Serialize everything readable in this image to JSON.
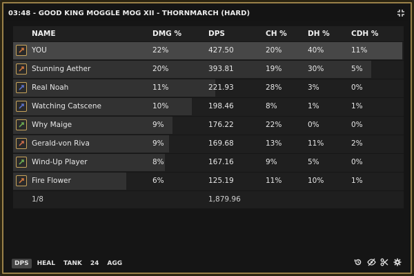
{
  "window": {
    "title": "03:48 - GOOD KING MOGGLE MOG XII - THORNMARCH (HARD)"
  },
  "columns": {
    "name": "NAME",
    "dmg_pct": "DMG %",
    "dps": "DPS",
    "ch_pct": "CH %",
    "dh_pct": "DH %",
    "cdh_pct": "CDH %"
  },
  "rows": [
    {
      "name": "YOU",
      "dmg_pct": "22%",
      "dps": "427.50",
      "ch_pct": "20%",
      "dh_pct": "40%",
      "cdh_pct": "11%",
      "job_icon": "bard-job-icon",
      "job_color": "#c9733a",
      "share": 1.0
    },
    {
      "name": "Stunning Aether",
      "dmg_pct": "20%",
      "dps": "393.81",
      "ch_pct": "19%",
      "dh_pct": "30%",
      "cdh_pct": "5%",
      "job_icon": "bard-job-icon",
      "job_color": "#c9733a",
      "share": 0.92
    },
    {
      "name": "Real Noah",
      "dmg_pct": "11%",
      "dps": "221.93",
      "ch_pct": "28%",
      "dh_pct": "3%",
      "cdh_pct": "0%",
      "job_icon": "dragoon-job-icon",
      "job_color": "#5a6fc4",
      "share": 0.52
    },
    {
      "name": "Watching Catscene",
      "dmg_pct": "10%",
      "dps": "198.46",
      "ch_pct": "8%",
      "dh_pct": "1%",
      "cdh_pct": "1%",
      "job_icon": "dragoon-job-icon",
      "job_color": "#5a6fc4",
      "share": 0.46
    },
    {
      "name": "Why Maige",
      "dmg_pct": "9%",
      "dps": "176.22",
      "ch_pct": "22%",
      "dh_pct": "0%",
      "cdh_pct": "0%",
      "job_icon": "healer-job-icon",
      "job_color": "#6aa84f",
      "share": 0.41
    },
    {
      "name": "Gerald-von Riva",
      "dmg_pct": "9%",
      "dps": "169.68",
      "ch_pct": "13%",
      "dh_pct": "11%",
      "cdh_pct": "2%",
      "job_icon": "machinist-job-icon",
      "job_color": "#c96b4a",
      "share": 0.4
    },
    {
      "name": "Wind-Up Player",
      "dmg_pct": "8%",
      "dps": "167.16",
      "ch_pct": "9%",
      "dh_pct": "5%",
      "cdh_pct": "0%",
      "job_icon": "healer-job-icon",
      "job_color": "#6aa84f",
      "share": 0.39
    },
    {
      "name": "Fire Flower",
      "dmg_pct": "6%",
      "dps": "125.19",
      "ch_pct": "11%",
      "dh_pct": "10%",
      "cdh_pct": "1%",
      "job_icon": "gladiator-job-icon",
      "job_color": "#c9733a",
      "share": 0.29
    }
  ],
  "footer": {
    "count": "1/8",
    "total_dps": "1,879.96"
  },
  "tabs": [
    {
      "label": "DPS",
      "active": true
    },
    {
      "label": "HEAL",
      "active": false
    },
    {
      "label": "TANK",
      "active": false
    },
    {
      "label": "24",
      "active": false
    },
    {
      "label": "AGG",
      "active": false
    }
  ],
  "tool_icons": [
    "history-icon",
    "hide-icon",
    "clear-icon",
    "settings-icon"
  ],
  "colors": {
    "frame_gold": "#9b8249",
    "bar_default": "#323232",
    "bar_self": "#474747"
  }
}
